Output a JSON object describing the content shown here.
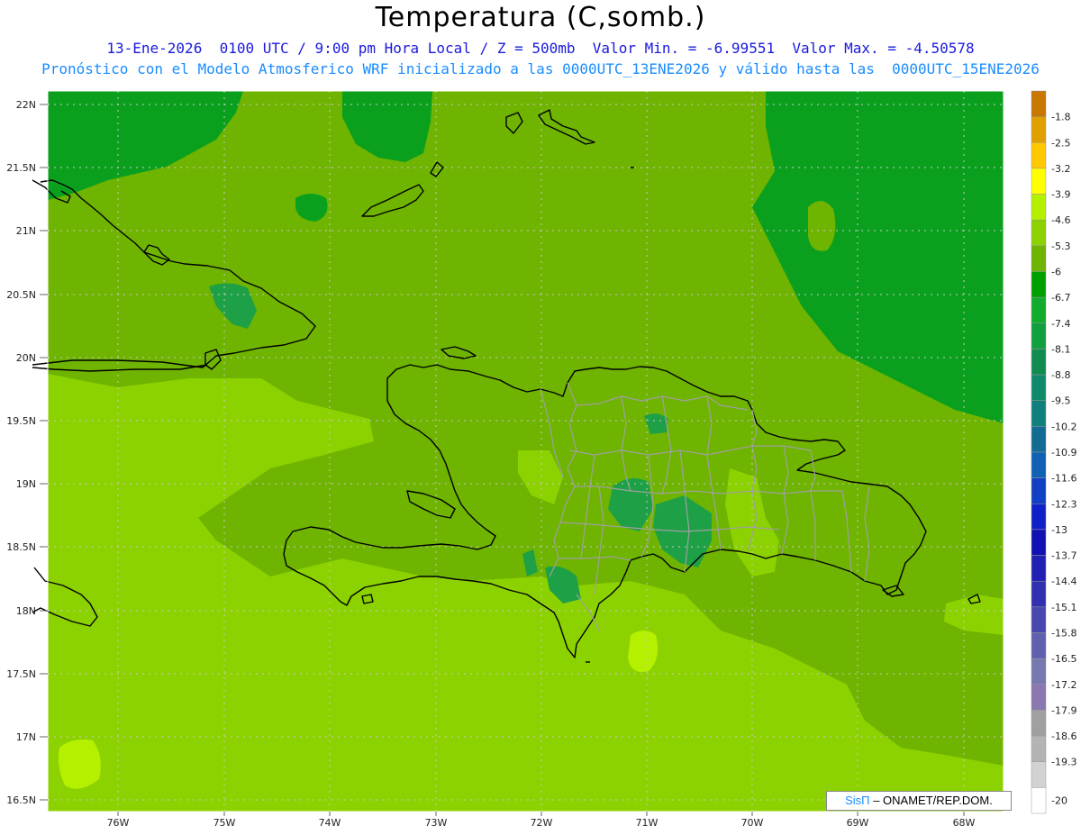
{
  "header": {
    "title": "Temperatura (C,somb.)",
    "line1": "13-Ene-2026  0100 UTC / 9:00 pm Hora Local / Z = 500mb  Valor Min. = -6.99551  Valor Max. = -4.50578",
    "line2": "Pronóstico con el Modelo Atmosferico WRF inicializado a las 0000UTC_13ENE2026 y válido hasta las  0000UTC_15ENE2026"
  },
  "axes": {
    "lat_labels": [
      "22N",
      "21.5N",
      "21N",
      "20.5N",
      "20N",
      "19.5N",
      "19N",
      "18.5N",
      "18N",
      "17.5N",
      "17N",
      "16.5N"
    ],
    "lon_labels": [
      "76W",
      "75W",
      "74W",
      "73W",
      "72W",
      "71W",
      "70W",
      "69W",
      "68W"
    ]
  },
  "legend": {
    "labels": [
      "-1.8",
      "-2.5",
      "-3.2",
      "-3.9",
      "-4.6",
      "-5.3",
      "-6",
      "-6.7",
      "-7.4",
      "-8.1",
      "-8.8",
      "-9.5",
      "-10.2",
      "-10.9",
      "-11.6",
      "-12.3",
      "-13",
      "-13.7",
      "-14.4",
      "-15.1",
      "-15.8",
      "-16.5",
      "-17.2",
      "-17.9",
      "-18.6",
      "-19.3",
      "-20"
    ],
    "colors": [
      "#c87800",
      "#e0a000",
      "#ffc800",
      "#ffff00",
      "#b4f000",
      "#8cd200",
      "#6eb400",
      "#00a000",
      "#12ac2c",
      "#10a040",
      "#108c50",
      "#108a6a",
      "#10807e",
      "#106c92",
      "#1060b4",
      "#1040c4",
      "#1020c8",
      "#1010b4",
      "#2020b4",
      "#3030b0",
      "#4848b0",
      "#6060b0",
      "#7878b0",
      "#8c78b0",
      "#a0a0a0",
      "#b4b4b4",
      "#d2d2d2"
    ]
  },
  "credit": {
    "brand": "SisΠ",
    "org": "– ONAMET/REP.DOM."
  },
  "colors": {
    "field_main": "#6eb400",
    "field_light": "#8cd200",
    "field_lighter": "#b4f000",
    "field_dark": "#0aa01e",
    "field_darker": "#1ea046",
    "coast": "#000000",
    "borders": "#a0a0a0"
  }
}
